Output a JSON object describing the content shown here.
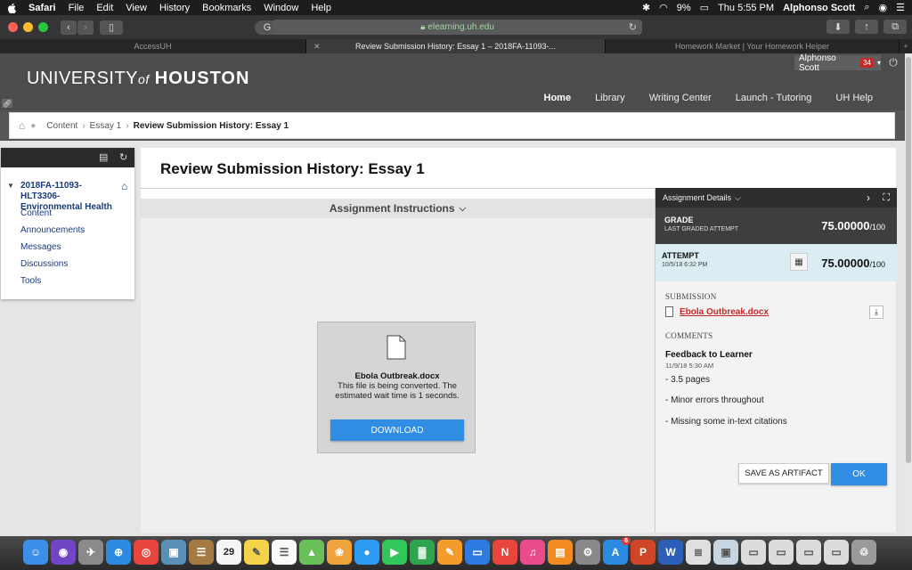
{
  "menubar": {
    "app": "Safari",
    "items": [
      "File",
      "Edit",
      "View",
      "History",
      "Bookmarks",
      "Window",
      "Help"
    ],
    "battery": "9%",
    "clock": "Thu 5:55 PM",
    "user": "Alphonso Scott"
  },
  "browser": {
    "url": "elearning.uh.edu",
    "tabs": [
      {
        "label": "AccessUH"
      },
      {
        "label": "Review Submission History: Essay 1 – 2018FA-11093-..."
      },
      {
        "label": "Homework Market | Your Homework Helper"
      }
    ]
  },
  "header": {
    "logo_pre": "UNIVERSITY",
    "logo_of": "of",
    "logo_post": "HOUSTON",
    "user_name": "Alphonso Scott",
    "notifications": "34",
    "nav": [
      "Home",
      "Library",
      "Writing Center",
      "Launch - Tutoring",
      "UH Help"
    ]
  },
  "breadcrumb": {
    "items": [
      "Content",
      "Essay 1"
    ],
    "current": "Review Submission History: Essay 1"
  },
  "course": {
    "title": "2018FA-11093-HLT3306-Environmental Health",
    "links": [
      "Content",
      "Announcements",
      "Messages",
      "Discussions",
      "Tools"
    ]
  },
  "main": {
    "title": "Review Submission History: Essay 1",
    "instructions_label": "Assignment Instructions",
    "doc_name": "Ebola Outbreak.docx",
    "doc_message": "This file is being converted. The estimated wait time is 1 seconds.",
    "download_label": "DOWNLOAD"
  },
  "details": {
    "header": "Assignment Details",
    "grade_label": "GRADE",
    "grade_sub": "LAST GRADED ATTEMPT",
    "grade_value": "75.00000",
    "grade_max": "/100",
    "attempt_label": "ATTEMPT",
    "attempt_date": "10/5/18 6:32 PM",
    "attempt_value": "75.00000",
    "attempt_max": "/100",
    "submission_label": "SUBMISSION",
    "file_name": "Ebola Outbreak.docx",
    "comments_label": "COMMENTS",
    "feedback_title": "Feedback to Learner",
    "feedback_date": "11/9/18 5:30 AM",
    "feedback_lines": [
      "- 3.5 pages",
      "- Minor errors throughout",
      "- Missing some in-text citations"
    ],
    "artifact_label": "SAVE AS ARTIFACT",
    "ok_label": "OK"
  },
  "dock": {
    "calendar_day": "29",
    "appstore_badge": "6"
  },
  "colors": {
    "accent_blue": "#2f8de4",
    "uh_header": "#4b4c4e",
    "link_blue": "#1a3b7a",
    "file_red": "#c62828"
  }
}
